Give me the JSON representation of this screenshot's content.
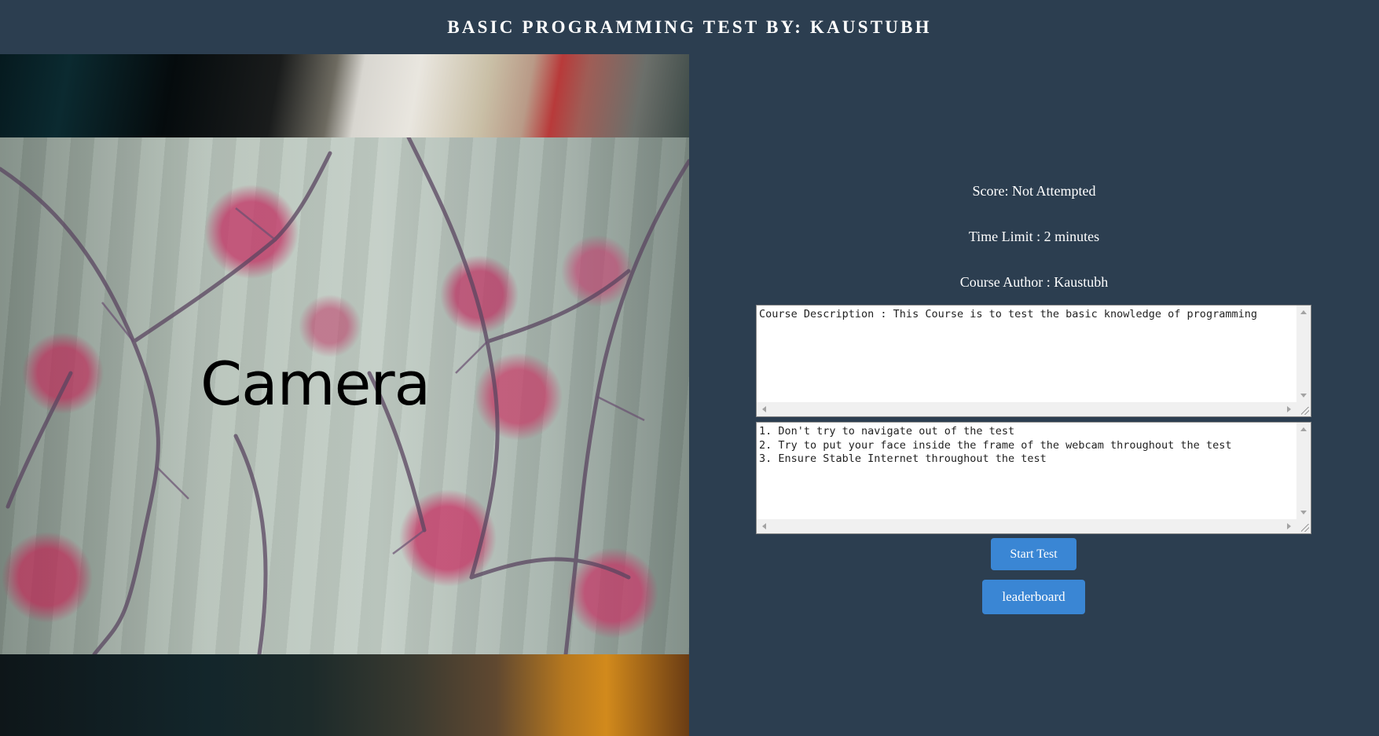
{
  "header": {
    "title": "BASIC PROGRAMMING TEST BY: KAUSTUBH"
  },
  "camera": {
    "label": "Camera"
  },
  "info": {
    "score": "Score: Not Attempted",
    "time_limit": "Time Limit : 2 minutes",
    "author": "Course Author : Kaustubh"
  },
  "description_box": {
    "text": "Course Description : This Course is to test the basic knowledge of programming"
  },
  "rules_box": {
    "text": "1. Don't try to navigate out of the test\n2. Try to put your face inside the frame of the webcam throughout the test\n3. Ensure Stable Internet throughout the test"
  },
  "buttons": {
    "start_test": "Start Test",
    "leaderboard": "leaderboard"
  },
  "colors": {
    "background": "#2c3e50",
    "button": "#3a86d4",
    "text": "#ffffff"
  }
}
